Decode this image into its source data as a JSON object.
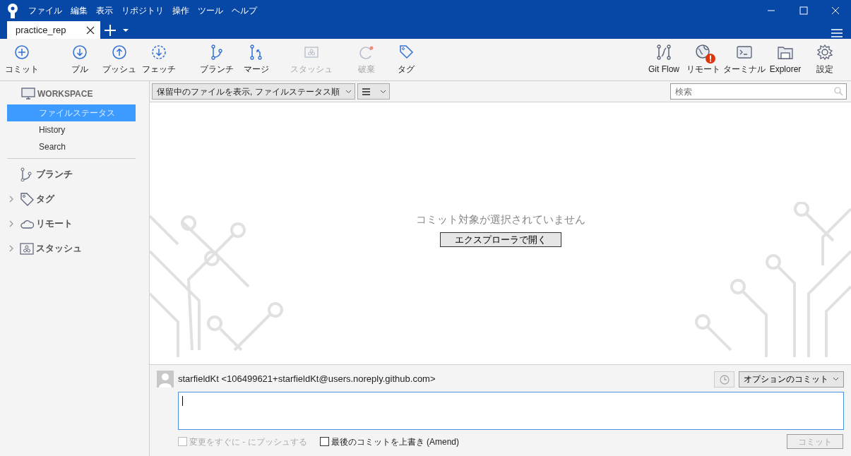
{
  "menu": [
    "ファイル",
    "編集",
    "表示",
    "リポジトリ",
    "操作",
    "ツール",
    "ヘルプ"
  ],
  "tabs": [
    {
      "label": "practice_rep",
      "selected": true
    }
  ],
  "toolbar_left": [
    {
      "label": "コミット",
      "disabled": false
    },
    {
      "label": "プル",
      "disabled": false
    },
    {
      "label": "プッシュ",
      "disabled": false
    },
    {
      "label": "フェッチ",
      "disabled": false
    },
    {
      "label": "ブランチ",
      "disabled": false
    },
    {
      "label": "マージ",
      "disabled": false
    },
    {
      "label": "スタッシュ",
      "disabled": true
    },
    {
      "label": "破棄",
      "disabled": true
    },
    {
      "label": "タグ",
      "disabled": false
    }
  ],
  "toolbar_right": [
    {
      "label": "Git Flow"
    },
    {
      "label": "リモート"
    },
    {
      "label": "ターミナル"
    },
    {
      "label": "Explorer"
    },
    {
      "label": "設定"
    }
  ],
  "sidebar": {
    "workspace": "WORKSPACE",
    "items": [
      {
        "label": "ファイルステータス",
        "selected": true
      },
      {
        "label": "History",
        "selected": false
      },
      {
        "label": "Search",
        "selected": false
      }
    ],
    "sections": [
      {
        "label": "ブランチ",
        "expandable": false
      },
      {
        "label": "タグ",
        "expandable": true
      },
      {
        "label": "リモート",
        "expandable": true
      },
      {
        "label": "スタッシュ",
        "expandable": true
      }
    ]
  },
  "filter": {
    "dropdown": "保留中のファイルを表示, ファイルステータス順",
    "search": {
      "placeholder": "検索"
    }
  },
  "empty_state": {
    "message": "コミット対象が選択されていません",
    "button": "エクスプローラで開く"
  },
  "commit": {
    "author": "starfieldKt <106499621+starfieldKt@users.noreply.github.com>",
    "options": "オプションのコミット",
    "checkboxes": [
      {
        "label": "変更をすぐに - にプッシュする",
        "checked": false,
        "disabled": true
      },
      {
        "label": "最後のコミットを上書き (Amend)",
        "checked": false,
        "disabled": false
      }
    ],
    "button": {
      "label": "コミット",
      "disabled": true
    }
  }
}
